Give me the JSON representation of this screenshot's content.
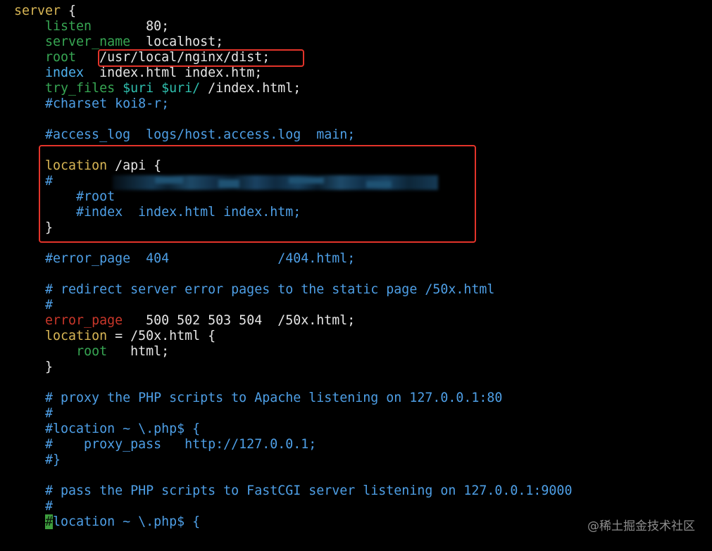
{
  "colors": {
    "plain": "#e6e6e6",
    "keyword_yellow": "#d8b655",
    "directive_green": "#37a653",
    "directive_blue": "#4fb1ee",
    "variable_teal": "#2fbfae",
    "error_red": "#c9372a",
    "comment": "#4e9fe6",
    "cursor_fg": "#0a1a0a",
    "cursor_bg": "#3e9e3e"
  },
  "lines": [
    {
      "tokens": [
        {
          "text": "server",
          "color": "keyword_yellow"
        },
        {
          "text": " {",
          "color": "plain"
        }
      ]
    },
    {
      "tokens": [
        {
          "text": "    ",
          "color": "plain"
        },
        {
          "text": "listen",
          "color": "directive_green"
        },
        {
          "text": "       80;",
          "color": "plain"
        }
      ]
    },
    {
      "tokens": [
        {
          "text": "    ",
          "color": "plain"
        },
        {
          "text": "server_name",
          "color": "directive_green"
        },
        {
          "text": "  localhost;",
          "color": "plain"
        }
      ]
    },
    {
      "tokens": [
        {
          "text": "    ",
          "color": "plain"
        },
        {
          "text": "root",
          "color": "directive_green"
        },
        {
          "text": "   /usr/local/nginx/dist;",
          "color": "plain"
        }
      ]
    },
    {
      "tokens": [
        {
          "text": "    ",
          "color": "plain"
        },
        {
          "text": "index",
          "color": "directive_blue"
        },
        {
          "text": "  index.html index.htm;",
          "color": "plain"
        }
      ]
    },
    {
      "tokens": [
        {
          "text": "    ",
          "color": "plain"
        },
        {
          "text": "try_files",
          "color": "directive_green"
        },
        {
          "text": " ",
          "color": "plain"
        },
        {
          "text": "$uri $uri/",
          "color": "variable_teal"
        },
        {
          "text": " /index.html;",
          "color": "plain"
        }
      ]
    },
    {
      "tokens": [
        {
          "text": "    #charset koi8-r;",
          "color": "comment"
        }
      ]
    },
    {
      "tokens": []
    },
    {
      "tokens": [
        {
          "text": "    #access_log  logs/host.access.log  main;",
          "color": "comment"
        }
      ]
    },
    {
      "tokens": []
    },
    {
      "tokens": [
        {
          "text": "    ",
          "color": "plain"
        },
        {
          "text": "location",
          "color": "keyword_yellow"
        },
        {
          "text": " /api {",
          "color": "plain"
        }
      ]
    },
    {
      "tokens": [
        {
          "text": "    #",
          "color": "comment"
        }
      ]
    },
    {
      "tokens": [
        {
          "text": "        #root",
          "color": "comment"
        }
      ]
    },
    {
      "tokens": [
        {
          "text": "        #index  index.html index.htm;",
          "color": "comment"
        }
      ]
    },
    {
      "tokens": [
        {
          "text": "    }",
          "color": "plain"
        }
      ]
    },
    {
      "tokens": []
    },
    {
      "tokens": [
        {
          "text": "    #error_page  404              /404.html;",
          "color": "comment"
        }
      ]
    },
    {
      "tokens": []
    },
    {
      "tokens": [
        {
          "text": "    # redirect server error pages to the static page /50x.html",
          "color": "comment"
        }
      ]
    },
    {
      "tokens": [
        {
          "text": "    #",
          "color": "comment"
        }
      ]
    },
    {
      "tokens": [
        {
          "text": "    ",
          "color": "plain"
        },
        {
          "text": "error_page",
          "color": "error_red"
        },
        {
          "text": "   500 502 503 504  /50x.html;",
          "color": "plain"
        }
      ]
    },
    {
      "tokens": [
        {
          "text": "    ",
          "color": "plain"
        },
        {
          "text": "location",
          "color": "keyword_yellow"
        },
        {
          "text": " = /50x.html {",
          "color": "plain"
        }
      ]
    },
    {
      "tokens": [
        {
          "text": "        ",
          "color": "plain"
        },
        {
          "text": "root",
          "color": "directive_green"
        },
        {
          "text": "   html;",
          "color": "plain"
        }
      ]
    },
    {
      "tokens": [
        {
          "text": "    }",
          "color": "plain"
        }
      ]
    },
    {
      "tokens": []
    },
    {
      "tokens": [
        {
          "text": "    # proxy the PHP scripts to Apache listening on 127.0.0.1:80",
          "color": "comment"
        }
      ]
    },
    {
      "tokens": [
        {
          "text": "    #",
          "color": "comment"
        }
      ]
    },
    {
      "tokens": [
        {
          "text": "    #location ~ \\.php$ {",
          "color": "comment"
        }
      ]
    },
    {
      "tokens": [
        {
          "text": "    #    proxy_pass   http://127.0.0.1;",
          "color": "comment"
        }
      ]
    },
    {
      "tokens": [
        {
          "text": "    #}",
          "color": "comment"
        }
      ]
    },
    {
      "tokens": []
    },
    {
      "tokens": [
        {
          "text": "    # pass the PHP scripts to FastCGI server listening on 127.0.0.1:9000",
          "color": "comment"
        }
      ]
    },
    {
      "tokens": [
        {
          "text": "    #",
          "color": "comment"
        }
      ]
    },
    {
      "tokens": [
        {
          "text": "    ",
          "color": "plain"
        },
        {
          "text": "#",
          "color": "cursor_fg",
          "bg": "cursor_bg"
        },
        {
          "text": "location ~ \\.php$ {",
          "color": "comment"
        }
      ]
    }
  ],
  "watermark": "@稀土掘金技术社区"
}
